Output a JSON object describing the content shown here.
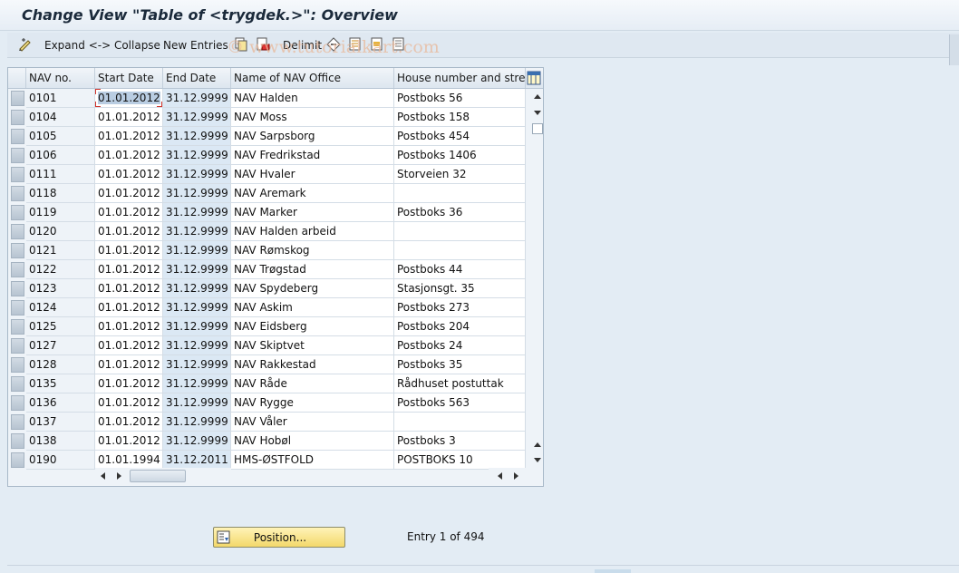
{
  "title": "Change View \"Table of <trygdek.>\": Overview",
  "toolbar": {
    "expand_collapse": "Expand <-> Collapse",
    "new_entries": "New Entries",
    "delimit": "Delimit"
  },
  "watermark": "© www.tutorialkart.com",
  "table": {
    "headers": [
      "NAV no.",
      "Start Date",
      "End Date",
      "Name of NAV Office",
      "House number and street"
    ],
    "rows": [
      [
        "0101",
        "01.01.2012",
        "31.12.9999",
        "NAV Halden",
        "Postboks 56"
      ],
      [
        "0104",
        "01.01.2012",
        "31.12.9999",
        "NAV Moss",
        "Postboks 158"
      ],
      [
        "0105",
        "01.01.2012",
        "31.12.9999",
        "NAV Sarpsborg",
        "Postboks 454"
      ],
      [
        "0106",
        "01.01.2012",
        "31.12.9999",
        "NAV Fredrikstad",
        "Postboks 1406"
      ],
      [
        "0111",
        "01.01.2012",
        "31.12.9999",
        "NAV Hvaler",
        "Storveien 32"
      ],
      [
        "0118",
        "01.01.2012",
        "31.12.9999",
        "NAV Aremark",
        ""
      ],
      [
        "0119",
        "01.01.2012",
        "31.12.9999",
        "NAV Marker",
        "Postboks 36"
      ],
      [
        "0120",
        "01.01.2012",
        "31.12.9999",
        "NAV Halden arbeid",
        ""
      ],
      [
        "0121",
        "01.01.2012",
        "31.12.9999",
        "NAV Rømskog",
        ""
      ],
      [
        "0122",
        "01.01.2012",
        "31.12.9999",
        "NAV Trøgstad",
        "Postboks 44"
      ],
      [
        "0123",
        "01.01.2012",
        "31.12.9999",
        "NAV Spydeberg",
        "Stasjonsgt. 35"
      ],
      [
        "0124",
        "01.01.2012",
        "31.12.9999",
        "NAV Askim",
        "Postboks 273"
      ],
      [
        "0125",
        "01.01.2012",
        "31.12.9999",
        "NAV Eidsberg",
        "Postboks 204"
      ],
      [
        "0127",
        "01.01.2012",
        "31.12.9999",
        "NAV Skiptvet",
        "Postboks 24"
      ],
      [
        "0128",
        "01.01.2012",
        "31.12.9999",
        "NAV Rakkestad",
        "Postboks 35"
      ],
      [
        "0135",
        "01.01.2012",
        "31.12.9999",
        "NAV Råde",
        "Rådhuset postuttak"
      ],
      [
        "0136",
        "01.01.2012",
        "31.12.9999",
        "NAV Rygge",
        "Postboks 563"
      ],
      [
        "0137",
        "01.01.2012",
        "31.12.9999",
        "NAV Våler",
        ""
      ],
      [
        "0138",
        "01.01.2012",
        "31.12.9999",
        "NAV Hobøl",
        "Postboks 3"
      ],
      [
        "0190",
        "01.01.1994",
        "31.12.2011",
        "HMS-ØSTFOLD",
        "POSTBOKS 10"
      ]
    ]
  },
  "position_button": "Position...",
  "entry_info": "Entry 1 of 494",
  "colors": {
    "accent": "#f3d86a",
    "header_bg": "#dde6ef",
    "end_date_bg": "#dbe8f4"
  },
  "icons": [
    "toggle-change-icon",
    "copy-icon",
    "delete-icon",
    "delimit-icon",
    "select-all-icon",
    "select-block-icon",
    "deselect-all-icon",
    "column-settings-icon",
    "position-icon"
  ]
}
